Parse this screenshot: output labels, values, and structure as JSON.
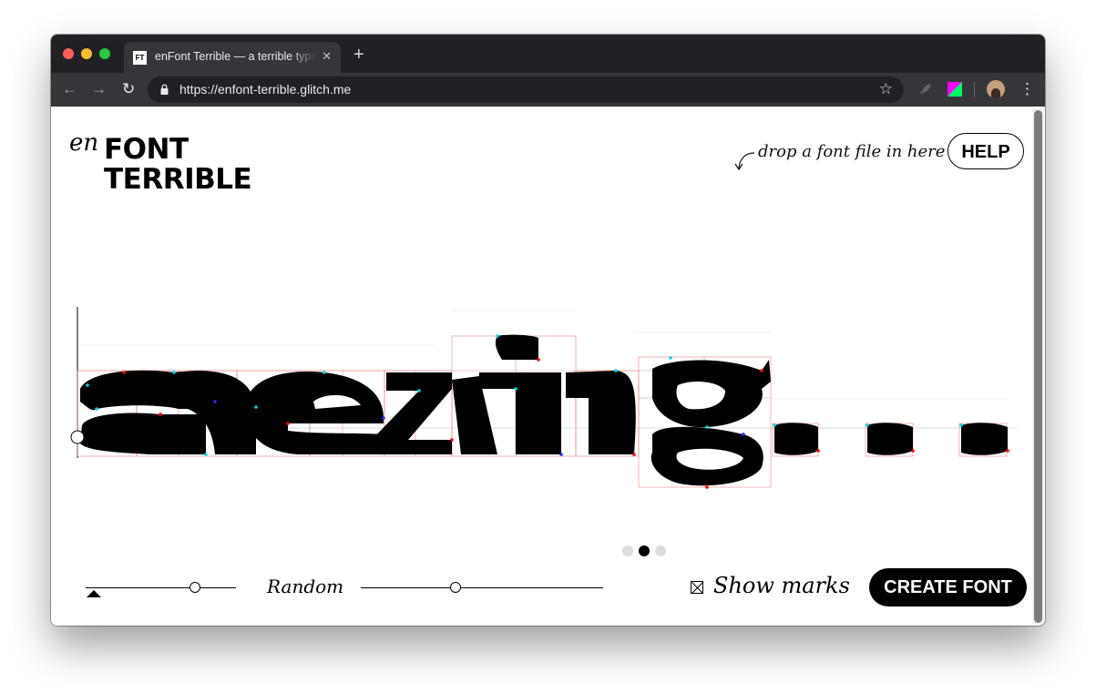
{
  "browser": {
    "tab_title": "enFont Terrible — a terrible typeface generator",
    "favicon_text": "FT",
    "url": "https://enfont-terrible.glitch.me",
    "icons": [
      "back-arrow-icon",
      "forward-arrow-icon",
      "reload-icon",
      "lock-icon",
      "star-icon",
      "rocket-extension-icon",
      "color-extension-icon",
      "profile-avatar",
      "menu-dots-icon",
      "close-icon",
      "plus-icon"
    ]
  },
  "logo": {
    "prefix": "en",
    "line1": "FONT",
    "line2": "TERRIBLE"
  },
  "drop_hint": "drop a font file in here",
  "help_label": "HELP",
  "preview_text": "amazing...",
  "controls": {
    "random_label": "Random",
    "left_slider_value": 0.73,
    "right_slider_value": 0.39,
    "pagination": {
      "count": 3,
      "active_index": 1
    },
    "show_marks_label": "Show marks",
    "show_marks_checked": true,
    "create_label": "CREATE FONT"
  },
  "colors": {
    "chrome_dark": "#202124",
    "chrome_toolbar": "#35363a",
    "accent": "#000000",
    "marks_red": "#ff0000",
    "marks_cyan": "#00d8e0",
    "marks_blue": "#2a2aff"
  }
}
